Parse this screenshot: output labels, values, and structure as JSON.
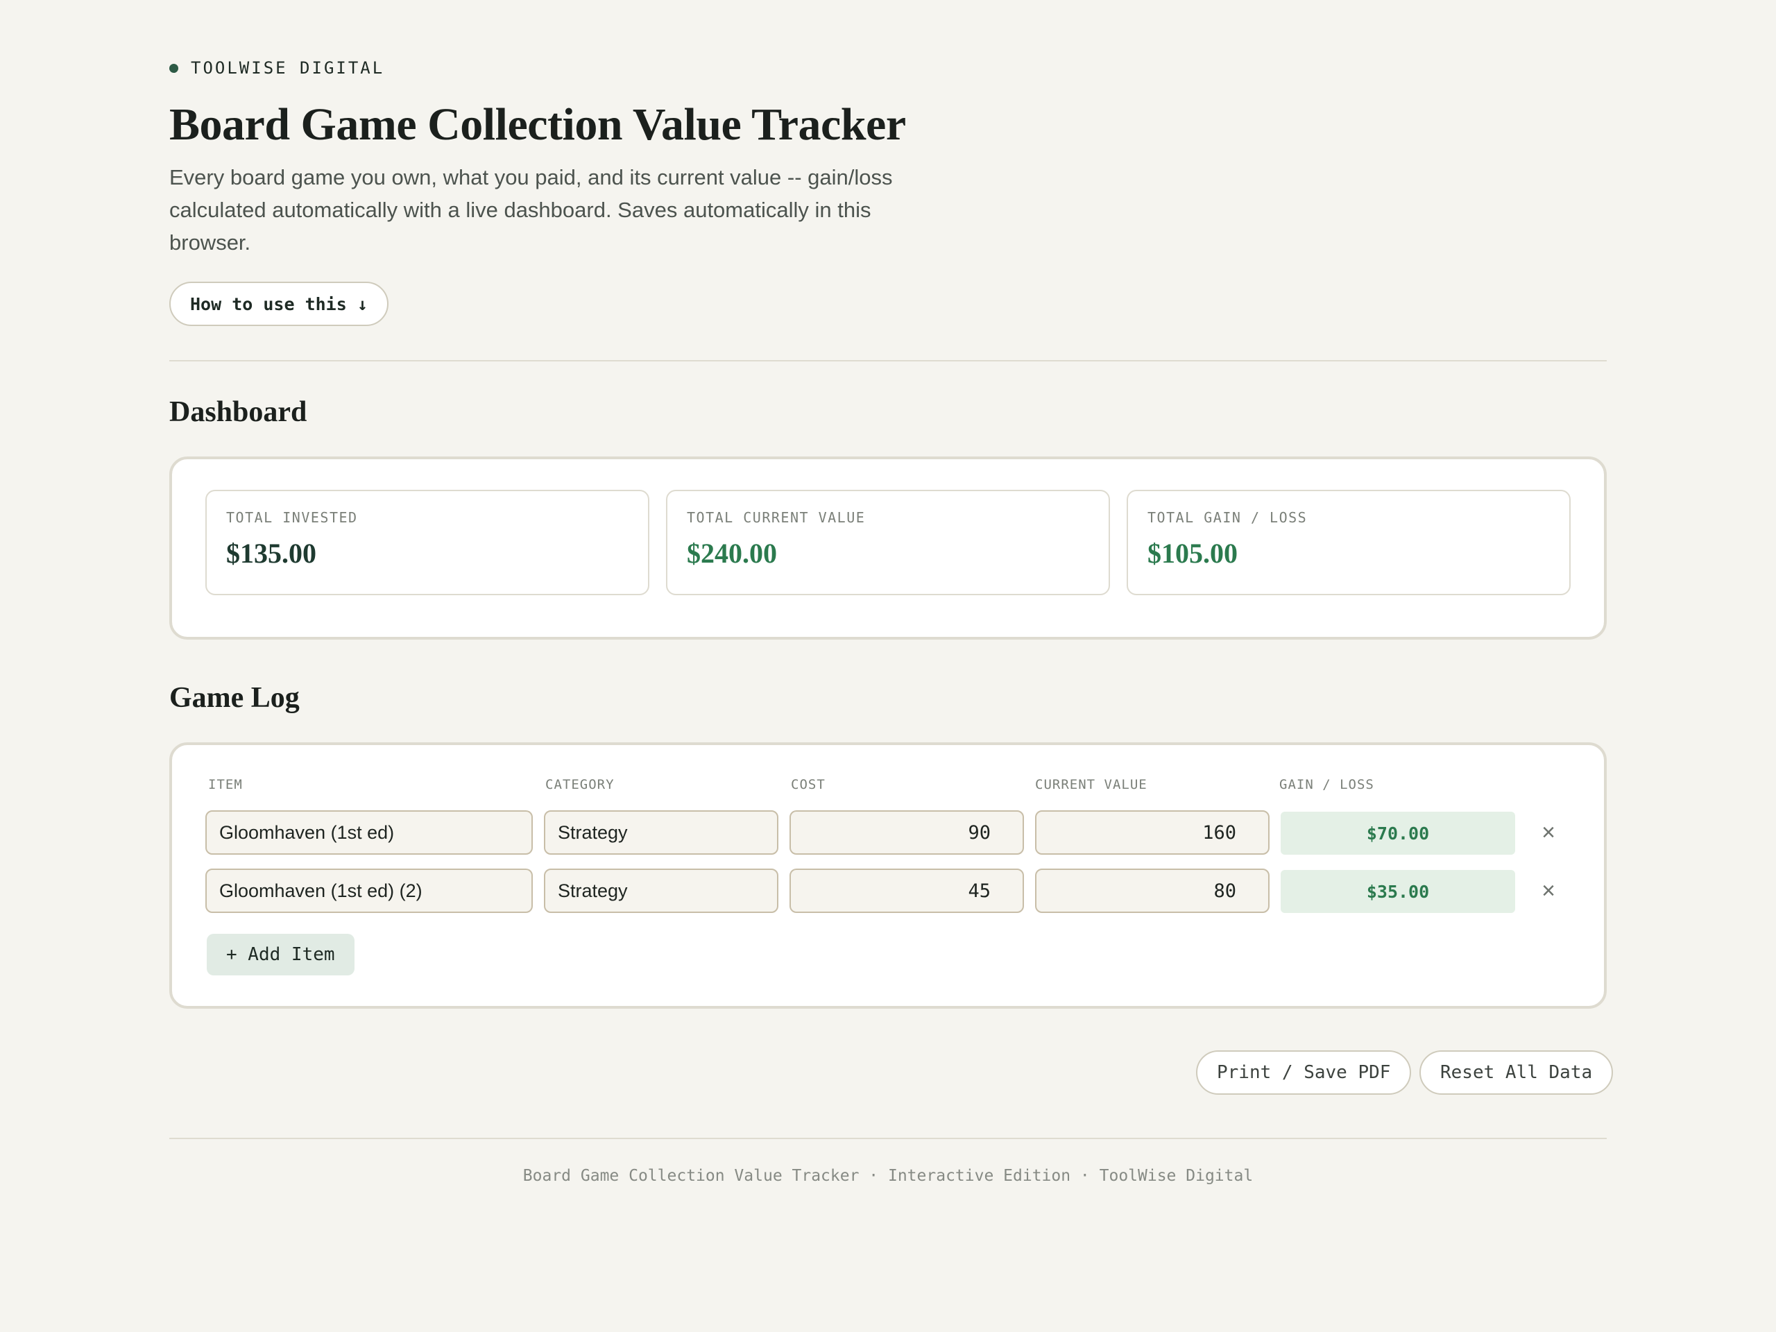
{
  "brand": {
    "name": "TOOLWISE DIGITAL"
  },
  "header": {
    "title": "Board Game Collection Value Tracker",
    "description": "Every board game you own, what you paid, and its current value -- gain/loss calculated automatically with a live dashboard. Saves automatically in this browser.",
    "howto_label": "How to use this ↓"
  },
  "dashboard": {
    "heading": "Dashboard",
    "cards": [
      {
        "label": "TOTAL INVESTED",
        "value": "$135.00"
      },
      {
        "label": "TOTAL CURRENT VALUE",
        "value": "$240.00"
      },
      {
        "label": "TOTAL GAIN / LOSS",
        "value": "$105.00"
      }
    ]
  },
  "game_log": {
    "heading": "Game Log",
    "columns": [
      "ITEM",
      "CATEGORY",
      "COST",
      "CURRENT VALUE",
      "GAIN / LOSS"
    ],
    "rows": [
      {
        "item": "Gloomhaven (1st ed)",
        "category": "Strategy",
        "cost": "90",
        "current_value": "160",
        "gain_loss": "$70.00"
      },
      {
        "item": "Gloomhaven (1st ed) (2)",
        "category": "Strategy",
        "cost": "45",
        "current_value": "80",
        "gain_loss": "$35.00"
      }
    ],
    "delete_icon": "×",
    "add_label": "+ Add Item"
  },
  "actions": {
    "print_label": "Print / Save PDF",
    "reset_label": "Reset All Data"
  },
  "footer": {
    "text": "Board Game Collection Value Tracker · Interactive Edition · ToolWise Digital"
  },
  "colors": {
    "accent": "#2d5a45",
    "positive": "#2b7a4e",
    "dark_value": "#1e3a30"
  }
}
